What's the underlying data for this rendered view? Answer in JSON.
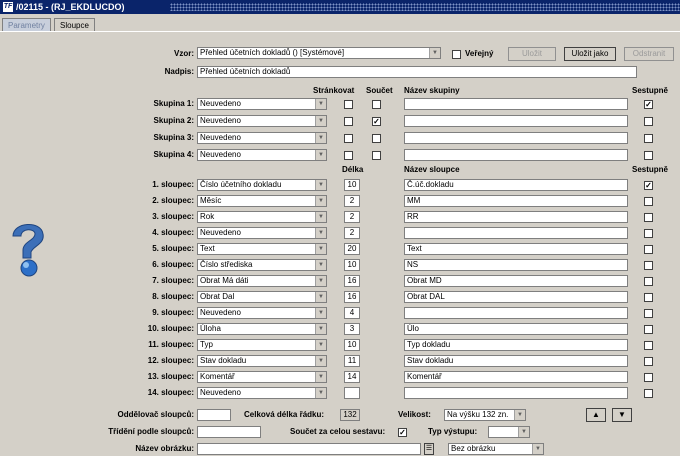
{
  "window": {
    "title": "/02115 - (RJ_EKDLUCDO)"
  },
  "tabs": [
    {
      "label": "Parametry"
    },
    {
      "label": "Sloupce"
    }
  ],
  "form": {
    "vzor_label": "Vzor:",
    "vzor_value": "Přehled účetních dokladů   ()   [Systémové]",
    "verejny_label": "Veřejný",
    "ulozit_label": "Uložit",
    "ulozit_jako_label": "Uložit jako",
    "odstranit_label": "Odstranit",
    "nadpis_label": "Nadpis:",
    "nadpis_value": "Přehled účetních dokladů"
  },
  "groups_header": {
    "strankovat": "Stránkovat",
    "soucet": "Součet",
    "nazev_skupiny": "Název skupiny",
    "sestupne": "Sestupně"
  },
  "groups": [
    {
      "label": "Skupina 1:",
      "value": "Neuvedeno",
      "strankovat": false,
      "soucet": false,
      "name": "",
      "sestupne": true
    },
    {
      "label": "Skupina 2:",
      "value": "Neuvedeno",
      "strankovat": false,
      "soucet": true,
      "name": "",
      "sestupne": false
    },
    {
      "label": "Skupina 3:",
      "value": "Neuvedeno",
      "strankovat": false,
      "soucet": false,
      "name": "",
      "sestupne": false
    },
    {
      "label": "Skupina 4:",
      "value": "Neuvedeno",
      "strankovat": false,
      "soucet": false,
      "name": "",
      "sestupne": false
    }
  ],
  "columns_header": {
    "delka": "Délka",
    "nazev_sloupce": "Název sloupce",
    "sestupne": "Sestupně"
  },
  "columns": [
    {
      "label": "1. sloupec:",
      "value": "Číslo účetního dokladu",
      "delka": "10",
      "name": "Č.úč.dokladu",
      "sestupne": true
    },
    {
      "label": "2. sloupec:",
      "value": "Měsíc",
      "delka": "2",
      "name": "MM",
      "sestupne": false
    },
    {
      "label": "3. sloupec:",
      "value": "Rok",
      "delka": "2",
      "name": "RR",
      "sestupne": false
    },
    {
      "label": "4. sloupec:",
      "value": "Neuvedeno",
      "delka": "2",
      "name": "",
      "sestupne": false
    },
    {
      "label": "5. sloupec:",
      "value": "Text",
      "delka": "20",
      "name": "Text",
      "sestupne": false
    },
    {
      "label": "6. sloupec:",
      "value": "Číslo střediska",
      "delka": "10",
      "name": "NS",
      "sestupne": false
    },
    {
      "label": "7. sloupec:",
      "value": "Obrat Má dáti",
      "delka": "16",
      "name": "Obrat MD",
      "sestupne": false
    },
    {
      "label": "8. sloupec:",
      "value": "Obrat Dal",
      "delka": "16",
      "name": "Obrat DAL",
      "sestupne": false
    },
    {
      "label": "9. sloupec:",
      "value": "Neuvedeno",
      "delka": "4",
      "name": "",
      "sestupne": false
    },
    {
      "label": "10. sloupec:",
      "value": "Úloha",
      "delka": "3",
      "name": "Úlo",
      "sestupne": false
    },
    {
      "label": "11. sloupec:",
      "value": "Typ",
      "delka": "10",
      "name": "Typ dokladu",
      "sestupne": false
    },
    {
      "label": "12. sloupec:",
      "value": "Stav dokladu",
      "delka": "11",
      "name": "Stav dokladu",
      "sestupne": false
    },
    {
      "label": "13. sloupec:",
      "value": "Komentář",
      "delka": "14",
      "name": "Komentář",
      "sestupne": false
    },
    {
      "label": "14. sloupec:",
      "value": "Neuvedeno",
      "delka": "",
      "name": "",
      "sestupne": false
    }
  ],
  "footer": {
    "oddelovac_label": "Oddělovač sloupců:",
    "oddelovac_value": "",
    "celkova_label": "Celková délka řádku:",
    "celkova_value": "132",
    "velikost_label": "Velikost:",
    "velikost_value": "Na výšku 132 zn.",
    "trideni_label": "Třídění podle sloupců:",
    "trideni_value": "",
    "soucet_label": "Součet za celou sestavu:",
    "soucet_checked": true,
    "typ_vystupu_label": "Typ výstupu:",
    "typ_vystupu_value": "",
    "nazev_obrazku_label": "Název obrázku:",
    "nazev_obrazku_value": "",
    "obrazek_select": "Bez obrázku"
  },
  "colors": {
    "titlebar": "#0a246a",
    "face": "#d4d0c8"
  }
}
